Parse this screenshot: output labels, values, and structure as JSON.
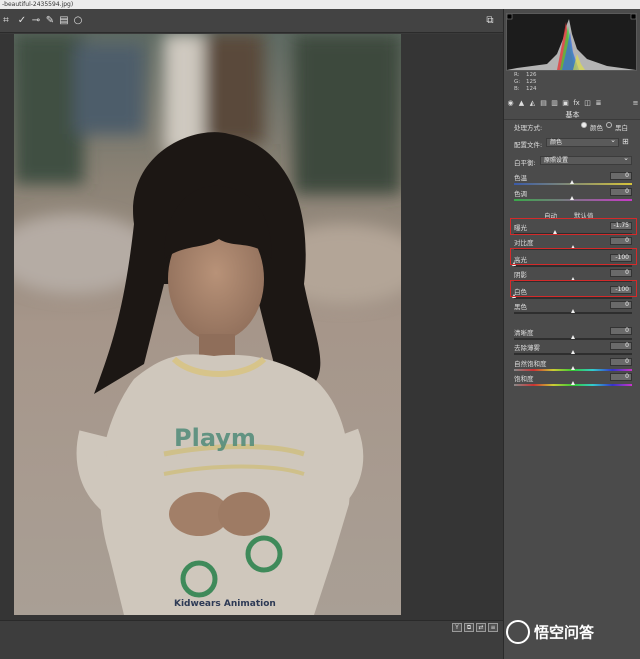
{
  "window": {
    "title": "-beautiful-2435594.jpg)"
  },
  "toolbar": {
    "tools": [
      "crop-icon",
      "straighten-icon",
      "spot-removal-icon",
      "brush-icon",
      "graduated-filter-icon",
      "radial-filter-icon"
    ],
    "right_tool": "fullscreen-icon"
  },
  "histogram": {
    "r_label": "R:",
    "r_value": "126",
    "g_label": "G:",
    "g_value": "125",
    "b_label": "B:",
    "b_value": "124"
  },
  "panel": {
    "section": "基本",
    "treatment_label": "处理方式:",
    "treatment_color": "颜色",
    "treatment_bw": "黑白",
    "profile_label": "配置文件:",
    "profile_value": "颜色",
    "wb_label": "白平衡:",
    "wb_value": "原照设置",
    "temp_label": "色温",
    "temp_value": "0",
    "tint_label": "色调",
    "tint_value": "0",
    "auto_label": "自动",
    "default_label": "默认值",
    "sliders": [
      {
        "label": "曝光",
        "value": "-1.75",
        "level": 0.35
      },
      {
        "label": "对比度",
        "value": "0",
        "level": 0.5
      },
      {
        "label": "高光",
        "value": "-100",
        "level": 0.0
      },
      {
        "label": "阴影",
        "value": "0",
        "level": 0.5
      },
      {
        "label": "白色",
        "value": "-100",
        "level": 0.0
      },
      {
        "label": "黑色",
        "value": "0",
        "level": 0.5
      },
      {
        "label": "清晰度",
        "value": "0",
        "level": 0.5
      },
      {
        "label": "去除薄雾",
        "value": "0",
        "level": 0.5
      },
      {
        "label": "自然饱和度",
        "value": "0",
        "level": 0.5
      },
      {
        "label": "饱和度",
        "value": "0",
        "level": 0.5
      }
    ]
  },
  "bottombar": {
    "buttons": [
      "Y",
      "⧉",
      "⇄",
      "≡"
    ]
  },
  "watermark": {
    "text": "悟空问答"
  },
  "colors": {
    "highlight_box": "#d42a2a",
    "panel_bg": "#4b4b4b"
  }
}
